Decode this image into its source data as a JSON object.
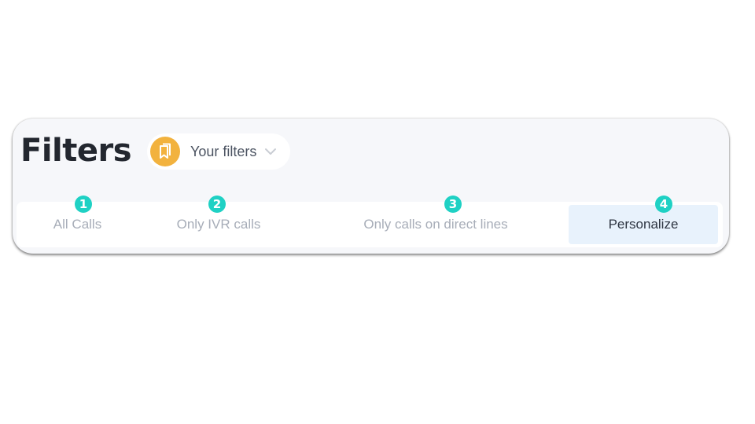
{
  "header": {
    "title": "Filters",
    "filters_dropdown": {
      "label": "Your filters",
      "icon": "bookmarks-icon",
      "chevron": "chevron-down-icon",
      "badge_color": "#f2b23e"
    }
  },
  "tabs": [
    {
      "label": "All Calls",
      "active": false
    },
    {
      "label": "Only IVR calls",
      "active": false
    },
    {
      "label": "Only calls on direct lines",
      "active": false
    },
    {
      "label": "Personalize",
      "active": true
    }
  ],
  "step_markers": [
    {
      "number": "1"
    },
    {
      "number": "2"
    },
    {
      "number": "3"
    },
    {
      "number": "4"
    }
  ],
  "colors": {
    "marker": "#1fd1c4",
    "active_tab_bg": "#e8f2fc"
  }
}
